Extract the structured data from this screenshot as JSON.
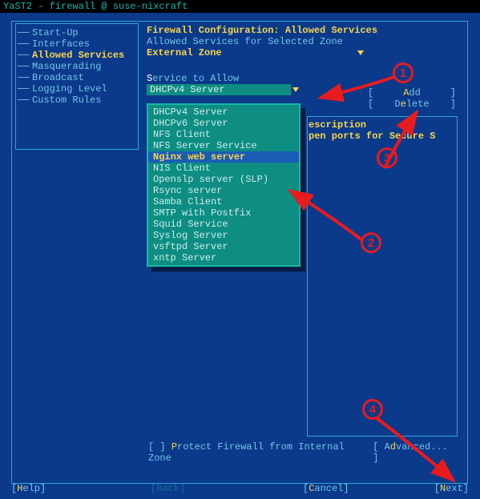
{
  "titlebar": "YaST2 - firewall @ suse-nixcraft",
  "sidebar": {
    "items": [
      {
        "label": "Start-Up"
      },
      {
        "label": "Interfaces"
      },
      {
        "label": "Allowed Services",
        "active": true
      },
      {
        "label": "Masquerading"
      },
      {
        "label": "Broadcast"
      },
      {
        "label": "Logging Level"
      },
      {
        "label": "Custom Rules"
      }
    ]
  },
  "content": {
    "heading": "Firewall Configuration: Allowed Services",
    "subheading": "Allowed Services for Selected Zone",
    "zone_label": "External Zone",
    "zone_value": " ",
    "svc_label_pre": "S",
    "svc_label_rest": "ervice to Allow",
    "svc_value": "DHCPv4 Server"
  },
  "actions": {
    "add_hot": "A",
    "add_rest": "dd",
    "del_pre": "D",
    "del_hot": "e",
    "del_rest": "lete"
  },
  "dropdown": {
    "items": [
      "DHCPv4 Server",
      "DHCPv6 Server",
      "NFS Client",
      "NFS Server Service",
      "Nginx web server",
      "NIS Client",
      "Openslp server (SLP)",
      "Rsync server",
      "Samba Client",
      "SMTP with Postfix",
      "Squid Service",
      "Syslog Server",
      "vsftpd Server",
      "xntp Server"
    ],
    "selected": "Nginx web server"
  },
  "desc": {
    "line1": "escription",
    "line2": "pen ports for Secure S"
  },
  "protect": {
    "checkbox_pre": "[ ] ",
    "checkbox_hot": "P",
    "checkbox_rest": "rotect Firewall from Internal Zone",
    "adv_pre": "[ A",
    "adv_hot": "d",
    "adv_rest": "vanced... ]"
  },
  "nav": {
    "help_pre": "[",
    "help_hot": "H",
    "help_rest": "elp]",
    "back": "[Back]",
    "cancel_pre": "[",
    "cancel_hot": "C",
    "cancel_rest": "ancel]",
    "next_pre": "[",
    "next_hot": "N",
    "next_rest": "ext]"
  },
  "annotations": {
    "c1": "1",
    "c2": "2",
    "c3": "3",
    "c4": "4"
  }
}
